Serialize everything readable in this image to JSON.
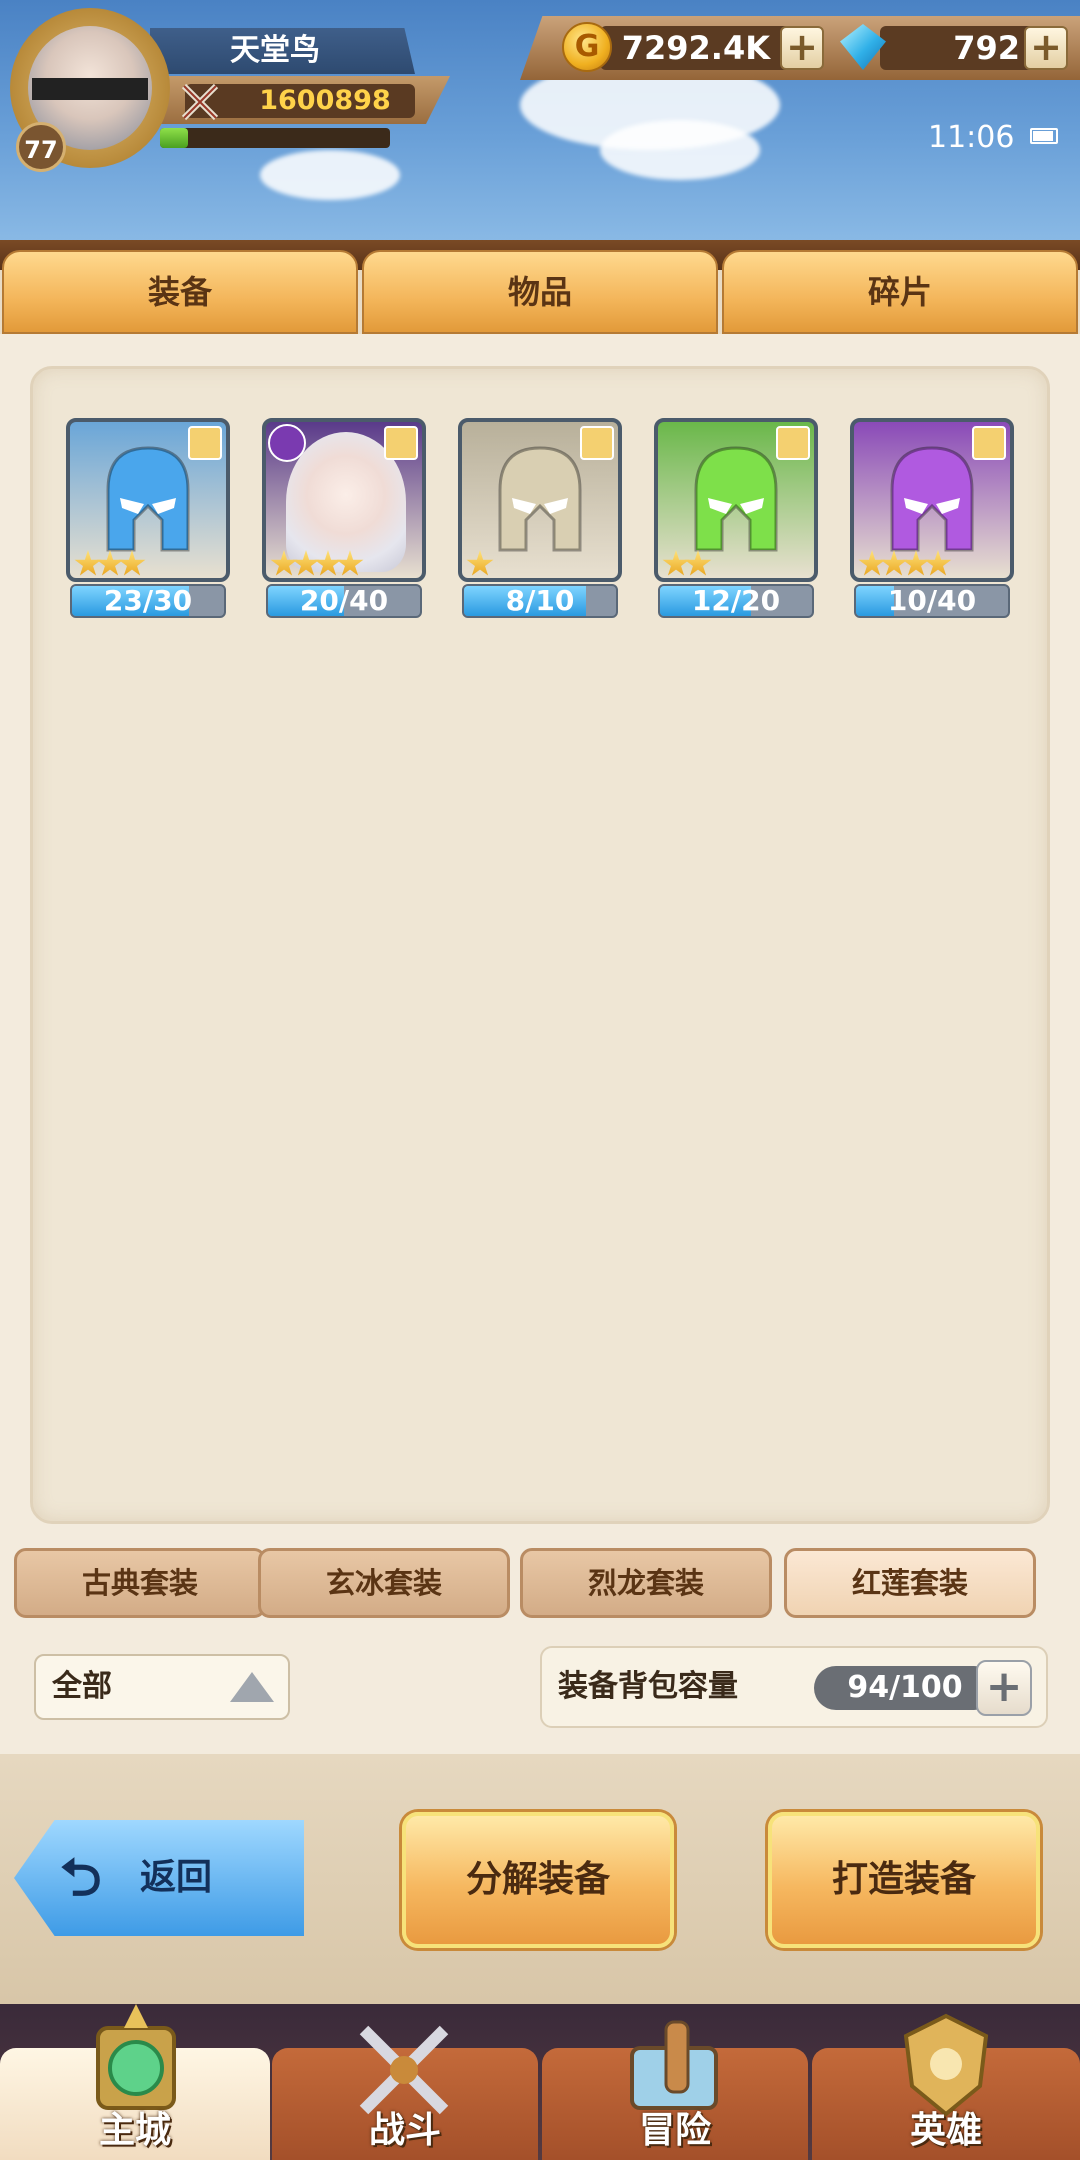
{
  "player": {
    "name": "天堂鸟",
    "power": "1600898",
    "level": "77",
    "exp_fraction": 0.12
  },
  "resources": {
    "gold": "7292.4K",
    "gems": "792",
    "gold_icon_glyph": "G"
  },
  "status": {
    "time": "11:06"
  },
  "tabs": [
    {
      "label": "装备"
    },
    {
      "label": "物品"
    },
    {
      "label": "碎片"
    }
  ],
  "items": [
    {
      "helmet_color": "#4aa6ec",
      "stars": 3,
      "progress": "23/30",
      "progress_fraction": 0.7667,
      "bg": "#6aa6d8"
    },
    {
      "helmet_color": "#e8e8ee",
      "stars": 4,
      "progress": "20/40",
      "progress_fraction": 0.5,
      "bg": "#5a3a8a",
      "hero": true
    },
    {
      "helmet_color": "#d9cfb2",
      "stars": 1,
      "progress": "8/10",
      "progress_fraction": 0.8,
      "bg": "#b8b09a"
    },
    {
      "helmet_color": "#7ee04a",
      "stars": 2,
      "progress": "12/20",
      "progress_fraction": 0.6,
      "bg": "#6ab84a"
    },
    {
      "helmet_color": "#b05ae0",
      "stars": 4,
      "progress": "10/40",
      "progress_fraction": 0.25,
      "bg": "#8a4ab8"
    }
  ],
  "sets": [
    {
      "label": "古典套装"
    },
    {
      "label": "玄冰套装"
    },
    {
      "label": "烈龙套装"
    },
    {
      "label": "红莲套装"
    }
  ],
  "filter": {
    "label": "全部"
  },
  "capacity": {
    "label": "装备背包容量",
    "value": "94/100"
  },
  "actions": {
    "back": "返回",
    "back_arrow_glyph": "⮌",
    "decompose": "分解装备",
    "forge": "打造装备"
  },
  "nav": [
    {
      "label": "主城"
    },
    {
      "label": "战斗"
    },
    {
      "label": "冒险"
    },
    {
      "label": "英雄"
    }
  ],
  "colors": {
    "accent_orange": "#f3b55a",
    "progress_blue": "#2a9ae0",
    "panel_bg": "#efe6d4"
  }
}
